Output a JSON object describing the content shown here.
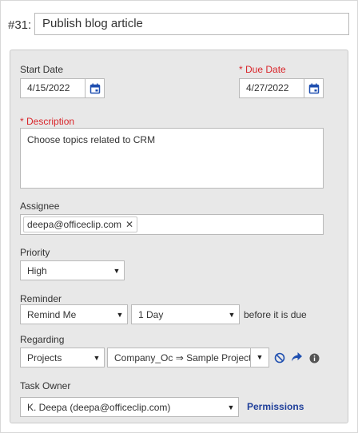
{
  "task": {
    "number_label": "#31:",
    "title": "Publish blog article"
  },
  "form": {
    "start_date": {
      "label": "Start Date",
      "value": "4/15/2022"
    },
    "due_date": {
      "required_mark": "*",
      "label": "Due Date",
      "value": "4/27/2022"
    },
    "description": {
      "required_mark": "*",
      "label": "Description",
      "value": "Choose topics related to CRM"
    },
    "assignee": {
      "label": "Assignee",
      "chips": [
        "deepa@officeclip.com"
      ],
      "remove_glyph": "✕"
    },
    "priority": {
      "label": "Priority",
      "selected": "High"
    },
    "reminder": {
      "label": "Reminder",
      "type_selected": "Remind Me",
      "interval_selected": "1 Day",
      "suffix": "before it is due"
    },
    "regarding": {
      "label": "Regarding",
      "module_selected": "Projects",
      "record_selected": "Company_Oc ⇒ Sample Project"
    },
    "task_owner": {
      "label": "Task Owner",
      "selected": "K. Deepa (deepa@officeclip.com)",
      "permissions_link": "Permissions"
    }
  },
  "icons": {
    "calendar": "calendar-icon",
    "clear": "ban-icon",
    "goto": "share-arrow-icon",
    "info": "info-icon",
    "caret": "chevron-down-icon"
  },
  "colors": {
    "required": "#d9262b",
    "calendar": "#1f4fb0",
    "link": "#1f3f9a",
    "panel_bg": "#e8e8e8"
  }
}
